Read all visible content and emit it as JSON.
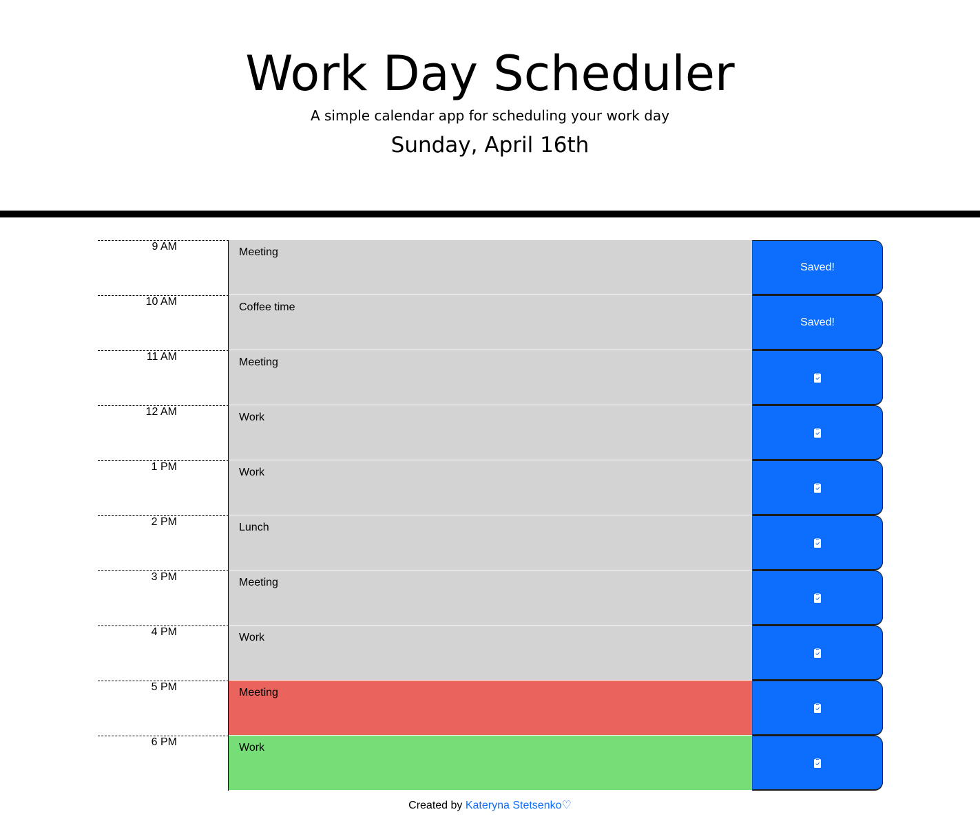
{
  "header": {
    "title": "Work Day Scheduler",
    "subtitle": "A simple calendar app for scheduling your work day",
    "current_date": "Sunday, April 16th"
  },
  "colors": {
    "past": "#d3d3d3",
    "present": "#ea635d",
    "future": "#77dd77",
    "save_button": "#0d6efd",
    "link": "#0d6efd"
  },
  "schedule": [
    {
      "hour": "9 AM",
      "text": "Meeting",
      "state": "past",
      "button": "Saved!"
    },
    {
      "hour": "10 AM",
      "text": "Coffee time",
      "state": "past",
      "button": "Saved!"
    },
    {
      "hour": "11 AM",
      "text": "Meeting",
      "state": "past",
      "button": "clipboard-check-icon"
    },
    {
      "hour": "12 AM",
      "text": "Work",
      "state": "past",
      "button": "clipboard-check-icon"
    },
    {
      "hour": "1 PM",
      "text": "Work",
      "state": "past",
      "button": "clipboard-check-icon"
    },
    {
      "hour": "2 PM",
      "text": "Lunch",
      "state": "past",
      "button": "clipboard-check-icon"
    },
    {
      "hour": "3 PM",
      "text": "Meeting",
      "state": "past",
      "button": "clipboard-check-icon"
    },
    {
      "hour": "4 PM",
      "text": "Work",
      "state": "past",
      "button": "clipboard-check-icon"
    },
    {
      "hour": "5 PM",
      "text": "Meeting",
      "state": "present",
      "button": "clipboard-check-icon"
    },
    {
      "hour": "6 PM",
      "text": "Work",
      "state": "future",
      "button": "clipboard-check-icon"
    }
  ],
  "footer": {
    "prefix": "Created by ",
    "author": "Kateryna Stetsenko",
    "heart": "♡"
  }
}
